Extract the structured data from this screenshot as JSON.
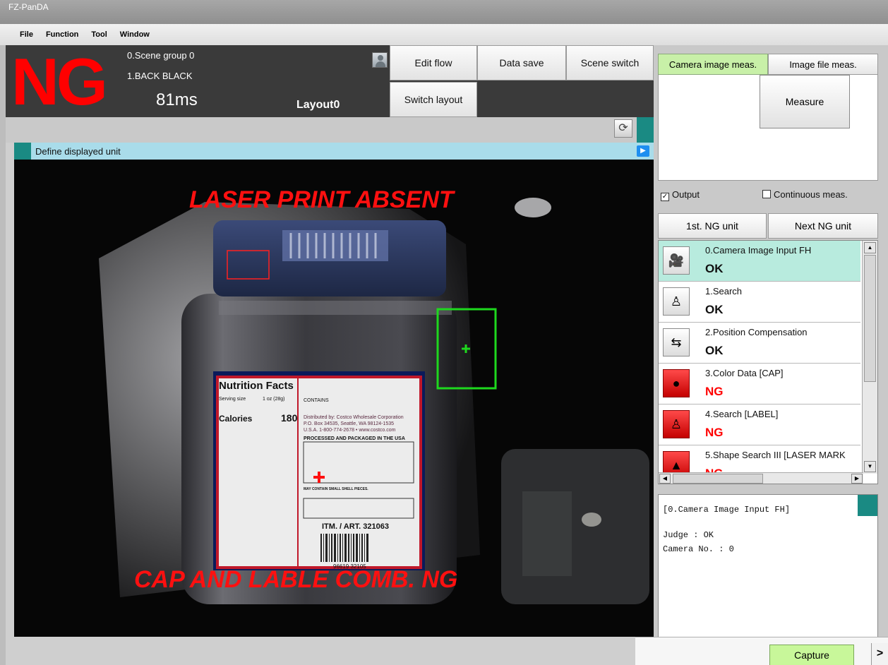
{
  "app": {
    "title": "FZ-PanDA"
  },
  "menu": [
    "File",
    "Function",
    "Tool",
    "Window"
  ],
  "status": {
    "judge": "NG",
    "scene_group": "0.Scene group 0",
    "scene": "1.BACK BLACK",
    "time": "81ms",
    "layout": "Layout0"
  },
  "buttons": {
    "edit_flow": "Edit flow",
    "data_save": "Data save",
    "scene_switch": "Scene switch",
    "switch_layout": "Switch layout"
  },
  "image_panel": {
    "title": "Define displayed unit",
    "overlay_top": "LASER PRINT ABSENT",
    "overlay_bottom": "CAP AND LABLE COMB. NG",
    "label": {
      "heading": "Nutrition Facts",
      "serving": "Serving size",
      "serving_value": "1 oz (28g)",
      "calories": "Calories",
      "calories_value": "180",
      "contains": "CONTAINS",
      "distributed": "Distributed by: Costco Wholesale Corporation",
      "address": "P.O. Box 34535, Seattle, WA 98124-1535",
      "phone": "U.S.A. 1-800-774-2678 • www.costco.com",
      "processed": "PROCESSED AND PACKAGED IN THE USA",
      "may_contain": "MAY CONTAIN SMALL SHELL PIECES.",
      "item": "ITM. / ART. 321063",
      "barcode": "96619 32105"
    }
  },
  "right_panel": {
    "tab_camera": "Camera image meas.",
    "tab_file": "Image file meas.",
    "measure": "Measure",
    "output": "Output",
    "output_checked": true,
    "continuous": "Continuous meas.",
    "continuous_checked": false,
    "first_ng": "1st. NG unit",
    "next_ng": "Next NG unit",
    "units": [
      {
        "name": "0.Camera Image Input FH",
        "judge": "OK",
        "icon": "camera-icon"
      },
      {
        "name": "1.Search",
        "judge": "OK",
        "icon": "search-unit-icon"
      },
      {
        "name": "2.Position Compensation",
        "judge": "OK",
        "icon": "position-compensation-icon"
      },
      {
        "name": "3.Color Data [CAP]",
        "judge": "NG",
        "icon": "color-data-icon"
      },
      {
        "name": "4.Search [LABEL]",
        "judge": "NG",
        "icon": "search-unit-icon"
      },
      {
        "name": "5.Shape Search III [LASER MARK",
        "judge": "NG",
        "icon": "shape-search-icon"
      }
    ],
    "detail": {
      "title": "[0.Camera Image Input FH]",
      "judge_line": "Judge : OK",
      "camera_line": "Camera No. : 0"
    }
  },
  "bottom": {
    "capture": "Capture",
    "more": ">"
  },
  "colors": {
    "ng_red": "#ff0000",
    "teal": "#1a8a83",
    "selected_row": "#b8ebde",
    "capture_green": "#c8f79a"
  }
}
